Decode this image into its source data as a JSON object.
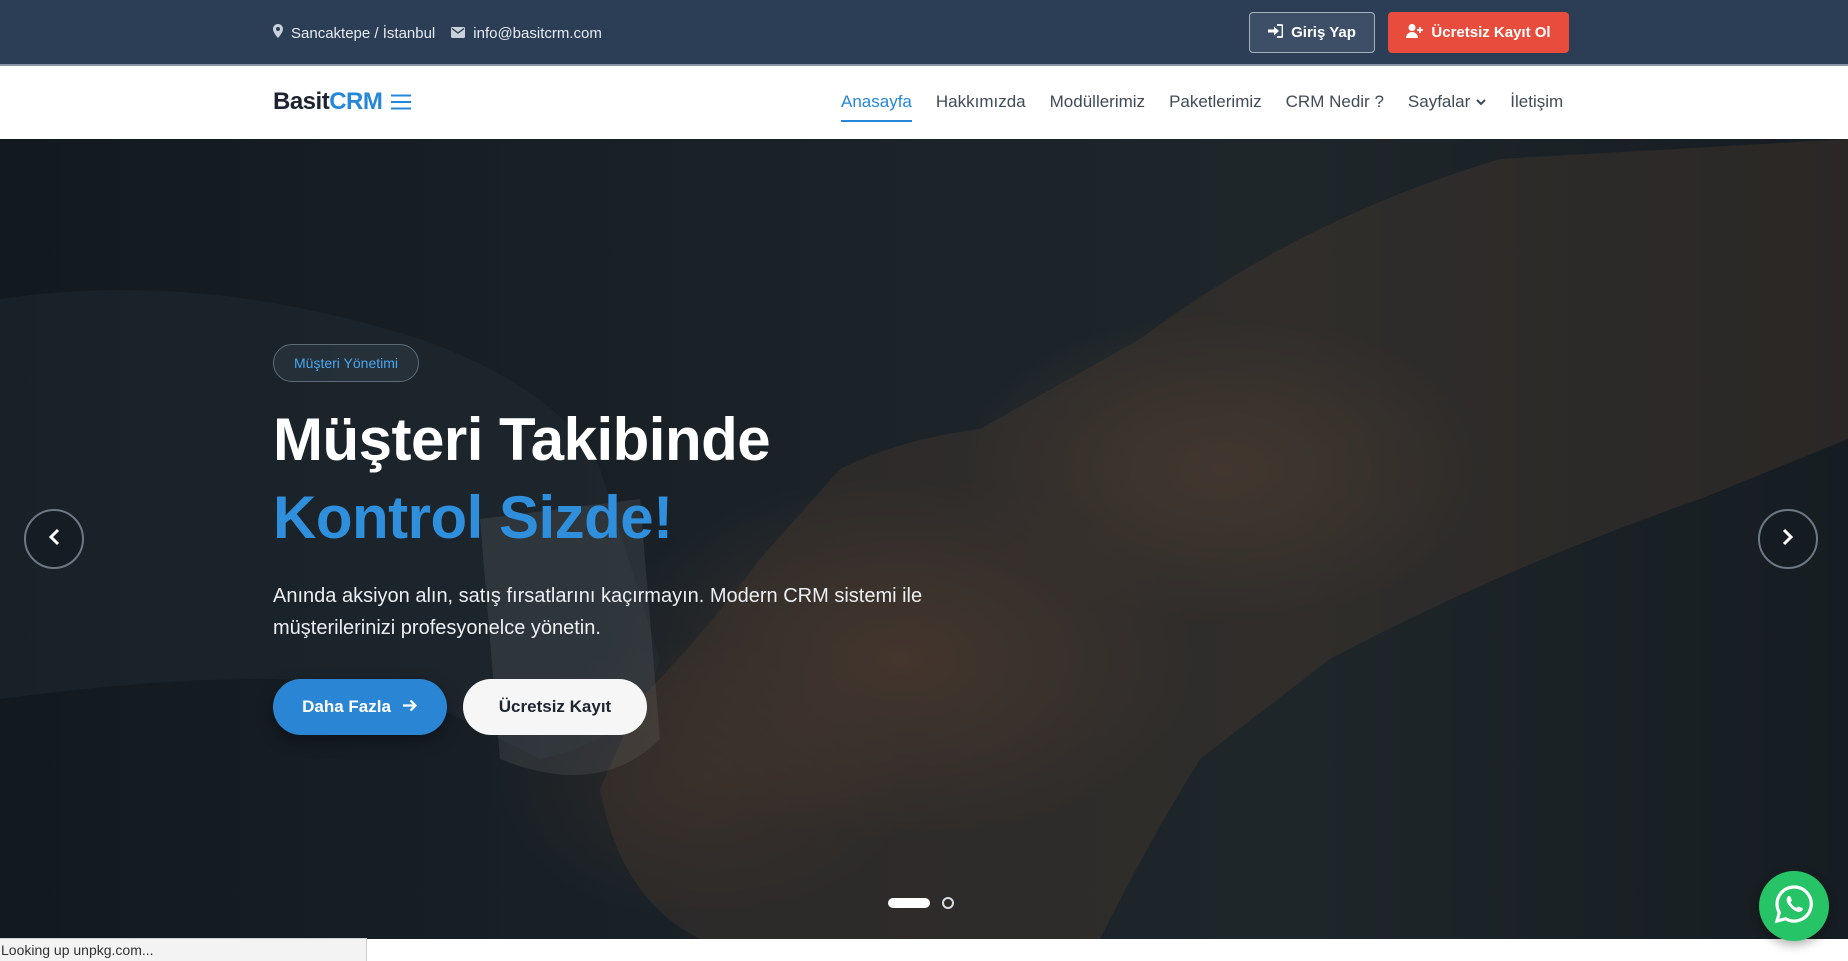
{
  "topbar": {
    "location": "Sancaktepe / İstanbul",
    "email": "info@basitcrm.com",
    "login_label": "Giriş Yap",
    "register_label": "Ücretsiz Kayıt Ol",
    "location_icon": "map-pin-icon",
    "email_icon": "envelope-icon"
  },
  "brand": {
    "name_part1": "Basit",
    "name_part2": "CRM",
    "accent_color": "#2587d6"
  },
  "nav": {
    "items": [
      {
        "label": "Anasayfa",
        "active": true
      },
      {
        "label": "Hakkımızda"
      },
      {
        "label": "Modüllerimiz"
      },
      {
        "label": "Paketlerimiz"
      },
      {
        "label": "CRM Nedir ?"
      },
      {
        "label": "Sayfalar",
        "has_dropdown": true
      },
      {
        "label": "İletişim"
      }
    ]
  },
  "hero": {
    "badge": "Müşteri Yönetimi",
    "title_line1": "Müşteri Takibinde",
    "title_line2": "Kontrol Sizde!",
    "description": "Anında aksiyon alın, satış fırsatlarını kaçırmayın. Modern CRM sistemi ile müşterilerinizi profesyonelce yönetin.",
    "primary_button": "Daha Fazla",
    "secondary_button": "Ücretsiz Kayıt",
    "slide_count": 2,
    "active_slide": 1
  },
  "status_bar": {
    "text": "Looking up unpkg.com..."
  },
  "colors": {
    "topbar_bg": "#2c3e56",
    "register_red": "#e74c3c",
    "primary_blue": "#2a86d4",
    "whatsapp_green": "#27c467"
  }
}
